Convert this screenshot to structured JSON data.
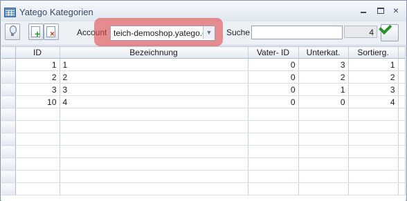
{
  "window": {
    "title": "Yatego Kategorien",
    "controls": [
      "–",
      "□",
      "×"
    ]
  },
  "toolbar": {
    "account_label": "Account",
    "account_value": "teich-demoshop.yatego.co",
    "search_label": "Suche",
    "search_value": "",
    "result_count": "4"
  },
  "table": {
    "headers": [
      "ID",
      "Bezeichnung",
      "Vater- ID",
      "Unterkat.",
      "Sortierg."
    ],
    "rows": [
      [
        "1",
        "1",
        "0",
        "3",
        "1"
      ],
      [
        "2",
        "2",
        "0",
        "2",
        "2"
      ],
      [
        "3",
        "3",
        "0",
        "1",
        "3"
      ],
      [
        "10",
        "4",
        "0",
        "0",
        "4"
      ]
    ]
  }
}
